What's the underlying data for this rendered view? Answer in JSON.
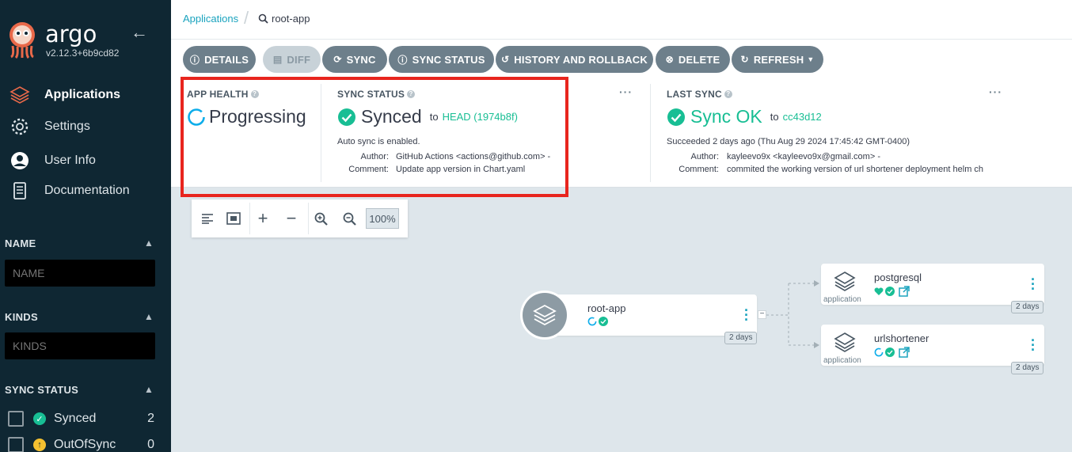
{
  "app": {
    "brand": "argo",
    "version": "v2.12.3+6b9cd82"
  },
  "sidebar": {
    "nav": [
      {
        "label": "Applications",
        "icon": "layers-icon",
        "active": true
      },
      {
        "label": "Settings",
        "icon": "gear-icon"
      },
      {
        "label": "User Info",
        "icon": "user-icon"
      },
      {
        "label": "Documentation",
        "icon": "book-icon"
      }
    ],
    "filters": {
      "name": {
        "title": "NAME",
        "placeholder": "NAME"
      },
      "kinds": {
        "title": "KINDS",
        "placeholder": "KINDS"
      },
      "sync_status": {
        "title": "SYNC STATUS",
        "items": [
          {
            "label": "Synced",
            "count": "2",
            "color": "#18be94"
          },
          {
            "label": "OutOfSync",
            "count": "0",
            "color": "#f4c030"
          }
        ]
      }
    }
  },
  "breadcrumb": {
    "root": "Applications",
    "current": "root-app"
  },
  "actions": {
    "details": "DETAILS",
    "diff": "DIFF",
    "sync": "SYNC",
    "sync_status": "SYNC STATUS",
    "history": "HISTORY AND ROLLBACK",
    "delete": "DELETE",
    "refresh": "REFRESH"
  },
  "status": {
    "health": {
      "title": "APP HEALTH",
      "value": "Progressing",
      "color": "#0dadea"
    },
    "sync": {
      "title": "SYNC STATUS",
      "value": "Synced",
      "to": "to",
      "revision": "HEAD (1974b8f)",
      "auto": "Auto sync is enabled.",
      "author_label": "Author:",
      "author": "GitHub Actions <actions@github.com> -",
      "comment_label": "Comment:",
      "comment": "Update app version in Chart.yaml",
      "color": "#18be94"
    },
    "last_sync": {
      "title": "LAST SYNC",
      "value": "Sync OK",
      "to": "to",
      "revision": "cc43d12",
      "succeeded": "Succeeded 2 days ago (Thu Aug 29 2024 17:45:42 GMT-0400)",
      "author_label": "Author:",
      "author": "kayleevo9x <kayleevo9x@gmail.com> -",
      "comment_label": "Comment:",
      "comment": "commited the working version of url shortener deployment helm ch"
    }
  },
  "graph": {
    "zoom": "100%",
    "root": {
      "name": "root-app",
      "age": "2 days"
    },
    "children": [
      {
        "name": "postgresql",
        "kind": "application",
        "age": "2 days",
        "health": "healthy"
      },
      {
        "name": "urlshortener",
        "kind": "application",
        "age": "2 days",
        "health": "progressing"
      }
    ],
    "collapse_symbol": "−"
  }
}
